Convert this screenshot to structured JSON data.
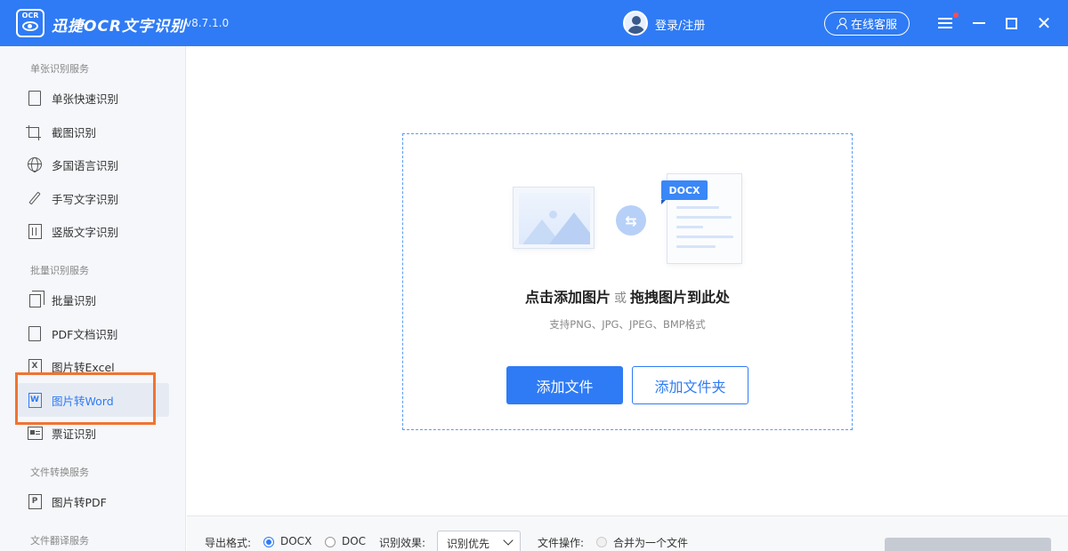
{
  "app": {
    "logo_text": "OCR",
    "name": "迅捷OCR文字识别",
    "version": "v8.7.1.0",
    "login_label": "登录/注册",
    "service_label": "在线客服"
  },
  "sidebar": {
    "sections": [
      {
        "title": "单张识别服务"
      },
      {
        "title": "批量识别服务"
      },
      {
        "title": "文件转换服务"
      },
      {
        "title": "文件翻译服务"
      }
    ],
    "items": [
      {
        "label": "单张快速识别",
        "icon": "document-icon"
      },
      {
        "label": "截图识别",
        "icon": "crop-icon"
      },
      {
        "label": "多国语言识别",
        "icon": "globe-icon"
      },
      {
        "label": "手写文字识别",
        "icon": "pen-icon"
      },
      {
        "label": "竖版文字识别",
        "icon": "vertical-text-icon"
      },
      {
        "label": "批量识别",
        "icon": "batch-icon"
      },
      {
        "label": "PDF文档识别",
        "icon": "pdf-icon"
      },
      {
        "label": "图片转Excel",
        "icon": "excel-icon",
        "glyph": "X"
      },
      {
        "label": "图片转Word",
        "icon": "word-icon",
        "glyph": "W",
        "active": true
      },
      {
        "label": "票证识别",
        "icon": "ticket-icon"
      },
      {
        "label": "图片转PDF",
        "icon": "pdf-convert-icon",
        "glyph": "P"
      }
    ]
  },
  "main": {
    "badge": "DOCX",
    "title_part1": "点击添加图片",
    "title_or": "或",
    "title_part2": "拖拽图片到此处",
    "subtitle": "支持PNG、JPG、JPEG、BMP格式",
    "add_file_button": "添加文件",
    "add_folder_button": "添加文件夹"
  },
  "bottombar": {
    "export_label": "导出格式:",
    "export_options": [
      "DOCX",
      "DOC"
    ],
    "export_selected": "DOCX",
    "effect_label": "识别效果:",
    "effect_value": "识别优先",
    "file_op_label": "文件操作:",
    "merge_label": "合并为一个文件"
  },
  "colors": {
    "brand": "#2f7bf5",
    "highlight": "#f07433"
  }
}
